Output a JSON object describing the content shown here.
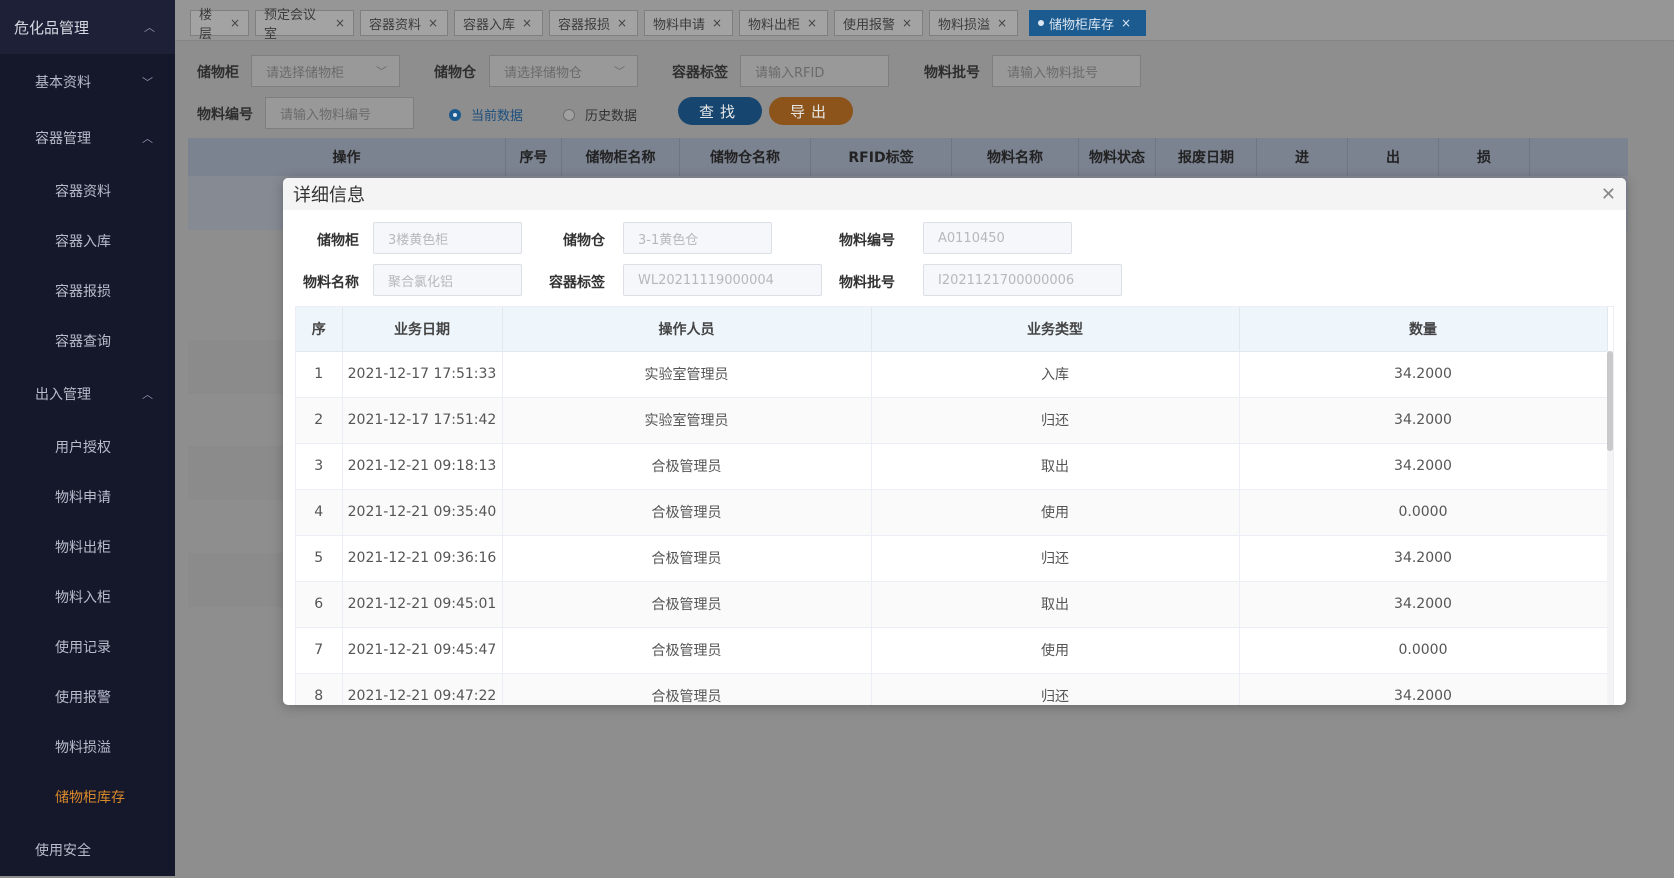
{
  "sidebar": {
    "top": "危化品管理",
    "groups": [
      {
        "label": "基本资料"
      },
      {
        "label": "容器管理"
      },
      {
        "label": "出入管理"
      },
      {
        "label": "使用安全"
      }
    ],
    "items": [
      {
        "label": "容器资料"
      },
      {
        "label": "容器入库"
      },
      {
        "label": "容器报损"
      },
      {
        "label": "容器查询"
      },
      {
        "label": "用户授权"
      },
      {
        "label": "物料申请"
      },
      {
        "label": "物料出柜"
      },
      {
        "label": "物料入柜"
      },
      {
        "label": "使用记录"
      },
      {
        "label": "使用报警"
      },
      {
        "label": "物料损溢"
      },
      {
        "label": "储物柜库存"
      }
    ]
  },
  "tabs": [
    {
      "label": "楼层"
    },
    {
      "label": "预定会议室"
    },
    {
      "label": "容器资料"
    },
    {
      "label": "容器入库"
    },
    {
      "label": "容器报损"
    },
    {
      "label": "物料申请"
    },
    {
      "label": "物料出柜"
    },
    {
      "label": "使用报警"
    },
    {
      "label": "物料损溢"
    },
    {
      "label": "储物柜库存"
    }
  ],
  "filters": {
    "cabinet_label": "储物柜",
    "cabinet_placeholder": "请选择储物柜",
    "bin_label": "储物仓",
    "bin_placeholder": "请选择储物仓",
    "tag_label": "容器标签",
    "tag_placeholder": "请输入RFID",
    "batch_label": "物料批号",
    "batch_placeholder": "请输入物料批号",
    "code_label": "物料编号",
    "code_placeholder": "请输入物料编号",
    "radio_current": "当前数据",
    "radio_history": "历史数据",
    "search_button": "查找",
    "export_button": "导出"
  },
  "bg_table": {
    "headers": [
      "操作",
      "序号",
      "储物柜名称",
      "储物仓名称",
      "RFID标签",
      "物料名称",
      "物料状态",
      "报废日期",
      "进",
      "出",
      "损"
    ]
  },
  "modal": {
    "title": "详细信息",
    "fields": {
      "cabinet_label": "储物柜",
      "cabinet_value": "3楼黄色柜",
      "bin_label": "储物仓",
      "bin_value": "3-1黄色仓",
      "code_label": "物料编号",
      "code_value": "A0110450",
      "name_label": "物料名称",
      "name_value": "聚合氯化铝",
      "tag_label": "容器标签",
      "tag_value": "WL20211119000004",
      "batch_label": "物料批号",
      "batch_value": "I2021121700000006"
    },
    "table": {
      "headers": [
        "序",
        "业务日期",
        "操作人员",
        "业务类型",
        "数量"
      ],
      "rows": [
        [
          "1",
          "2021-12-17 17:51:33",
          "实验室管理员",
          "入库",
          "34.2000"
        ],
        [
          "2",
          "2021-12-17 17:51:42",
          "实验室管理员",
          "归还",
          "34.2000"
        ],
        [
          "3",
          "2021-12-21 09:18:13",
          "合极管理员",
          "取出",
          "34.2000"
        ],
        [
          "4",
          "2021-12-21 09:35:40",
          "合极管理员",
          "使用",
          "0.0000"
        ],
        [
          "5",
          "2021-12-21 09:36:16",
          "合极管理员",
          "归还",
          "34.2000"
        ],
        [
          "6",
          "2021-12-21 09:45:01",
          "合极管理员",
          "取出",
          "34.2000"
        ],
        [
          "7",
          "2021-12-21 09:45:47",
          "合极管理员",
          "使用",
          "0.0000"
        ],
        [
          "8",
          "2021-12-21 09:47:22",
          "合极管理员",
          "归还",
          "34.2000"
        ]
      ]
    }
  }
}
